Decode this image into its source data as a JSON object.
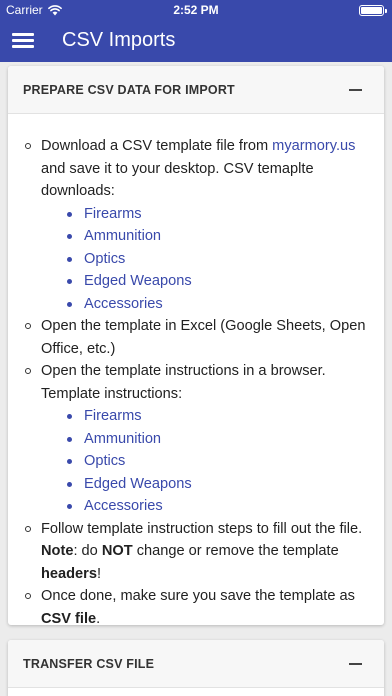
{
  "status_bar": {
    "carrier": "Carrier",
    "time": "2:52 PM"
  },
  "app_bar": {
    "title": "CSV Imports",
    "menu_icon": "hamburger-menu-icon"
  },
  "colors": {
    "primary": "#3949ab",
    "background": "#ececec",
    "card_header": "#f7f7f7"
  },
  "section_prepare": {
    "title": "PREPARE CSV DATA FOR IMPORT",
    "step1": {
      "text_a": "Download a CSV template file from ",
      "link": "myarmory.us",
      "text_b": " and save it to your desktop. CSV temaplte downloads:",
      "downloads": [
        "Firearms",
        "Ammunition",
        "Optics",
        "Edged Weapons",
        "Accessories"
      ]
    },
    "step2": {
      "text": "Open the template in Excel (Google Sheets, Open Office, etc.)"
    },
    "step3": {
      "text": "Open the template instructions in a browser. Template instructions:",
      "instructions": [
        "Firearms",
        "Ammunition",
        "Optics",
        "Edged Weapons",
        "Accessories"
      ]
    },
    "step4": {
      "text_a": "Follow template instruction steps to fill out the file. ",
      "note_label": "Note",
      "text_b": ": do ",
      "not_word": "NOT",
      "text_c": " change or remove the template ",
      "headers_word": "headers",
      "text_d": "!"
    },
    "step5": {
      "text_a": "Once done, make sure you save the template as ",
      "csv_word": "CSV file",
      "text_b": "."
    }
  },
  "section_transfer": {
    "title": "TRANSFER CSV FILE"
  }
}
